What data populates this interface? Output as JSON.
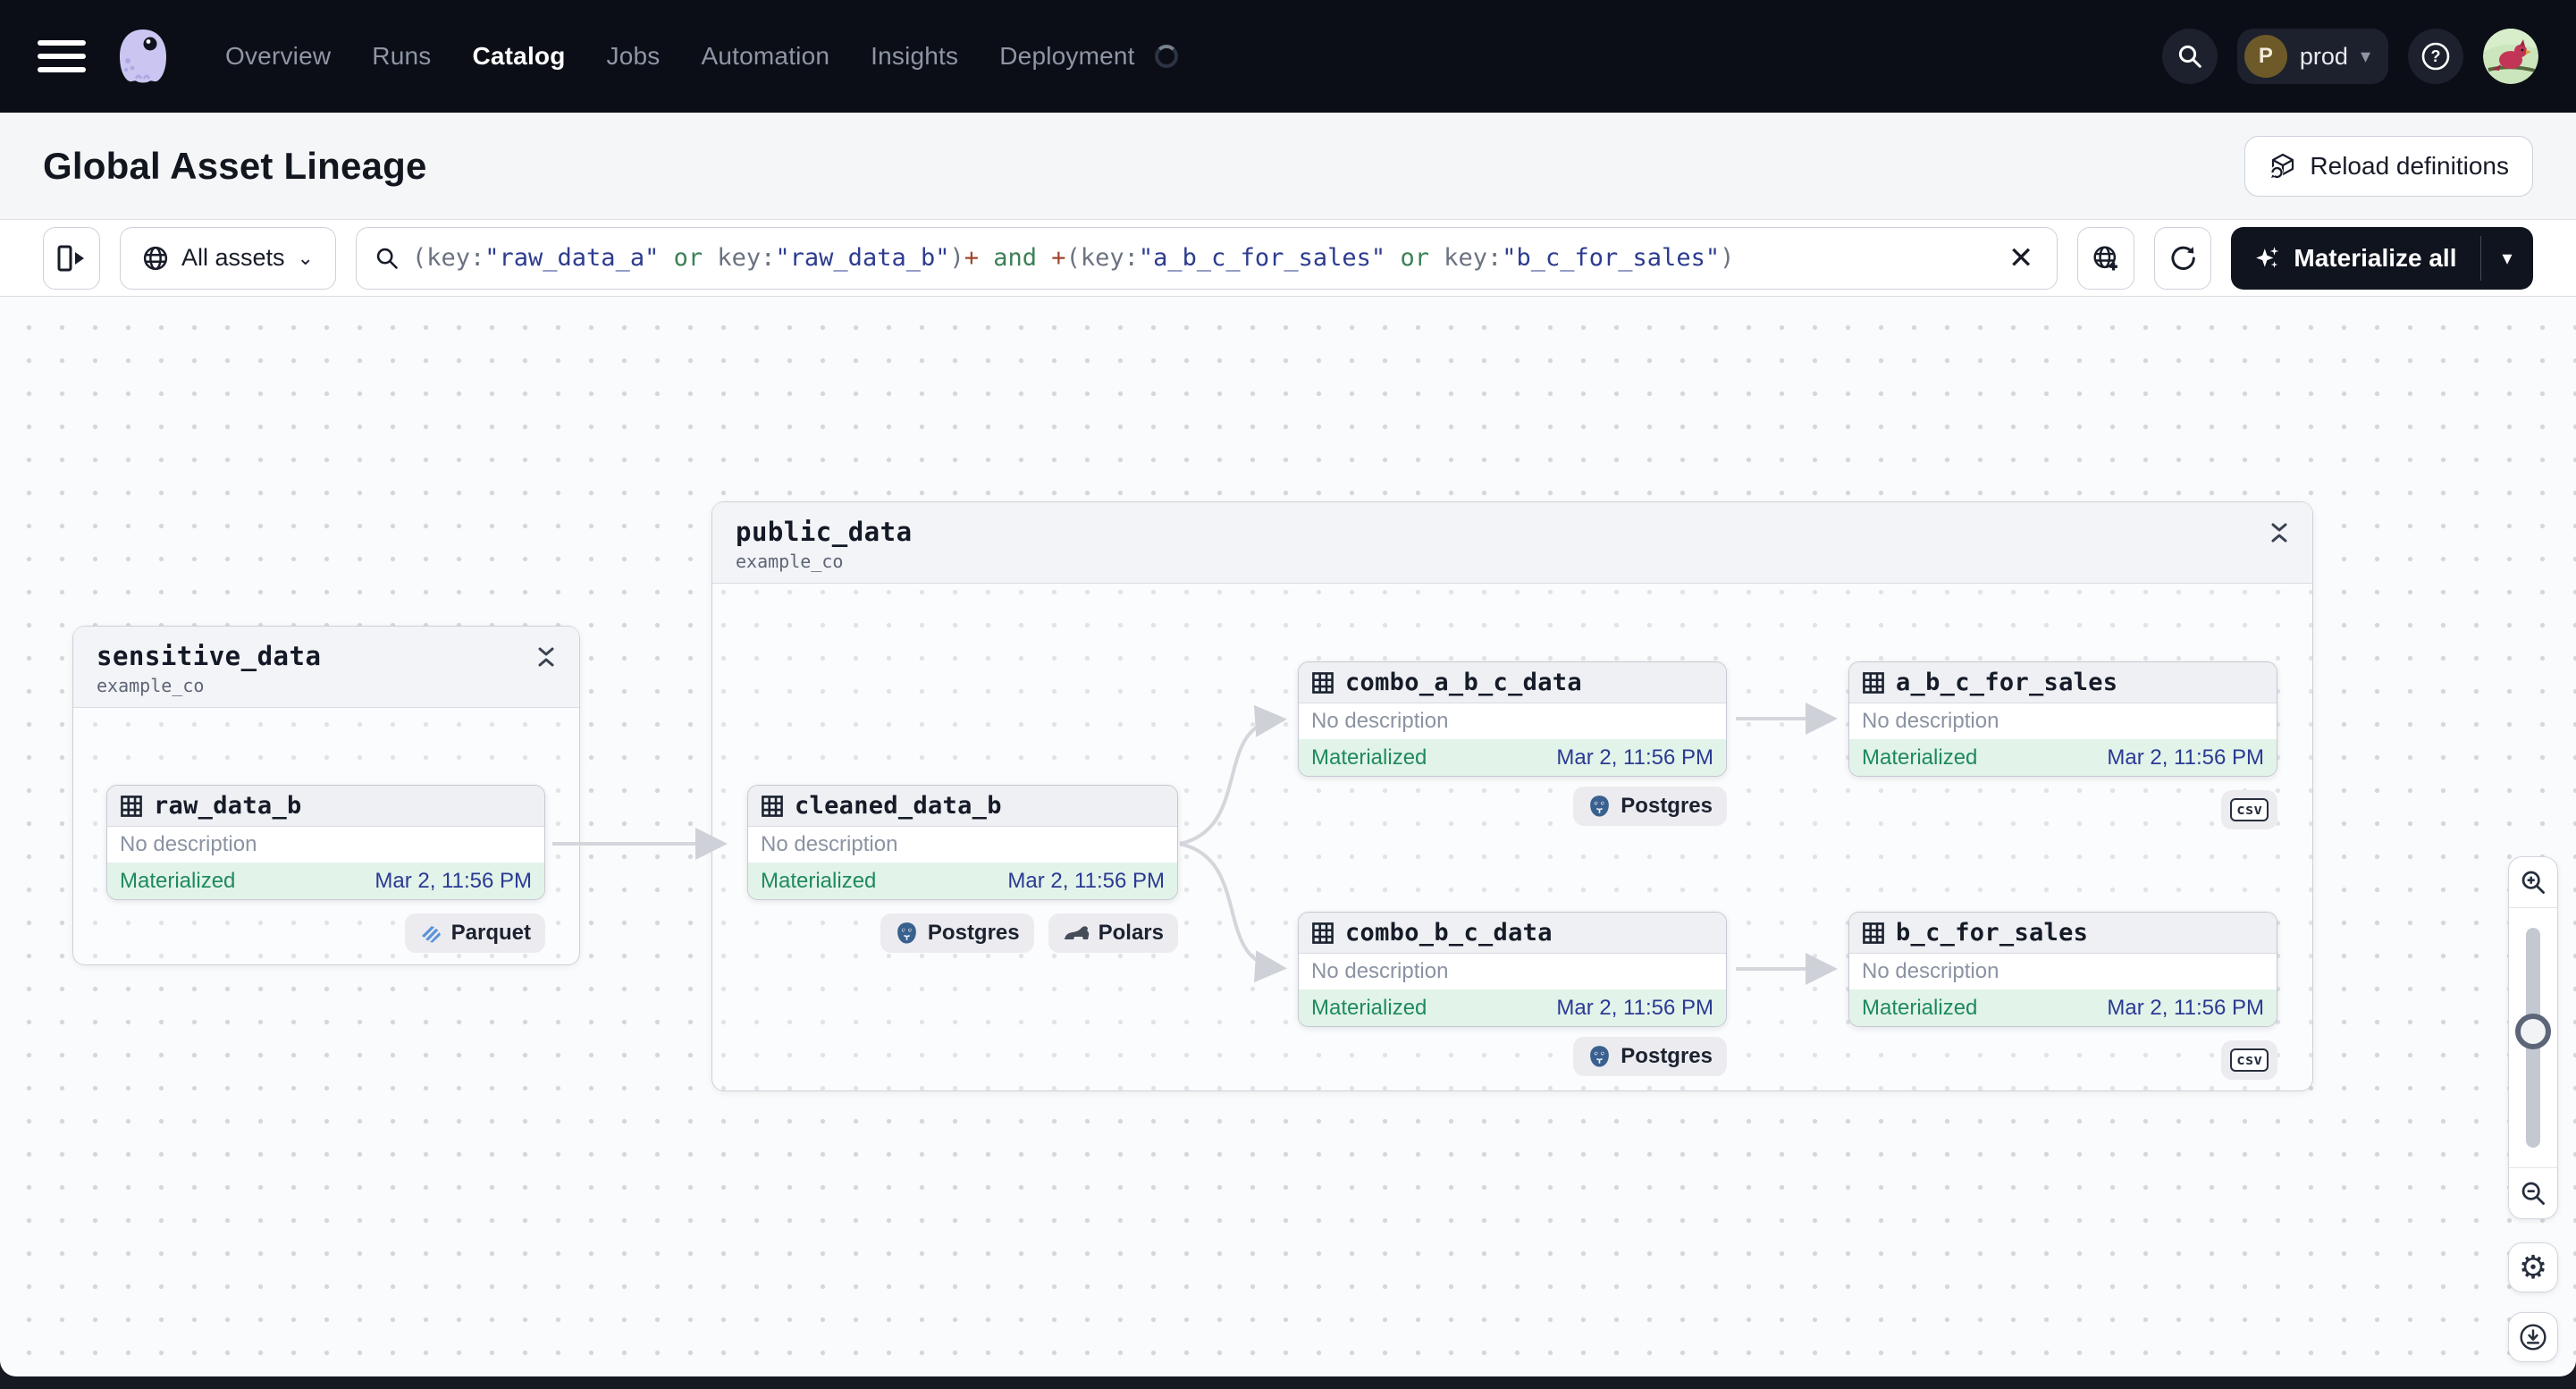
{
  "nav": {
    "items": [
      "Overview",
      "Runs",
      "Catalog",
      "Jobs",
      "Automation",
      "Insights",
      "Deployment"
    ],
    "active_item": "Catalog",
    "deployment_pill": {
      "initial": "P",
      "label": "prod"
    }
  },
  "page_header": {
    "title": "Global Asset Lineage",
    "reload_label": "Reload definitions"
  },
  "toolbar": {
    "scope_label": "All assets",
    "clear_label": "✕",
    "materialize_label": "Materialize all",
    "query_segments": [
      {
        "text": "(key:",
        "type": "punct"
      },
      {
        "text": "\"raw_data_a\"",
        "type": "str"
      },
      {
        "text": " or ",
        "type": "kw"
      },
      {
        "text": "key:",
        "type": "punct"
      },
      {
        "text": "\"raw_data_b\"",
        "type": "str"
      },
      {
        "text": ")",
        "type": "punct"
      },
      {
        "text": "+",
        "type": "plus"
      },
      {
        "text": " and ",
        "type": "kw"
      },
      {
        "text": "+",
        "type": "plus"
      },
      {
        "text": "(key:",
        "type": "punct"
      },
      {
        "text": "\"a_b_c_for_sales\"",
        "type": "str"
      },
      {
        "text": " or ",
        "type": "kw"
      },
      {
        "text": "key:",
        "type": "punct"
      },
      {
        "text": "\"b_c_for_sales\"",
        "type": "str"
      },
      {
        "text": ")",
        "type": "punct"
      }
    ]
  },
  "graph": {
    "groups": [
      {
        "name": "sensitive_data",
        "subtitle": "example_co"
      },
      {
        "name": "public_data",
        "subtitle": "example_co"
      }
    ],
    "assets": [
      {
        "name": "raw_data_b",
        "description": "No description",
        "status": "Materialized",
        "timestamp": "Mar 2, 11:56 PM",
        "badges": [
          {
            "label": "Parquet",
            "icon": "parquet"
          }
        ]
      },
      {
        "name": "cleaned_data_b",
        "description": "No description",
        "status": "Materialized",
        "timestamp": "Mar 2, 11:56 PM",
        "badges": [
          {
            "label": "Postgres",
            "icon": "postgres"
          },
          {
            "label": "Polars",
            "icon": "polars"
          }
        ]
      },
      {
        "name": "combo_a_b_c_data",
        "description": "No description",
        "status": "Materialized",
        "timestamp": "Mar 2, 11:56 PM",
        "badges": [
          {
            "label": "Postgres",
            "icon": "postgres"
          }
        ]
      },
      {
        "name": "a_b_c_for_sales",
        "description": "No description",
        "status": "Materialized",
        "timestamp": "Mar 2, 11:56 PM",
        "badges": [
          {
            "label": "csv",
            "icon": "csv"
          }
        ]
      },
      {
        "name": "combo_b_c_data",
        "description": "No description",
        "status": "Materialized",
        "timestamp": "Mar 2, 11:56 PM",
        "badges": [
          {
            "label": "Postgres",
            "icon": "postgres"
          }
        ]
      },
      {
        "name": "b_c_for_sales",
        "description": "No description",
        "status": "Materialized",
        "timestamp": "Mar 2, 11:56 PM",
        "badges": [
          {
            "label": "csv",
            "icon": "csv"
          }
        ]
      }
    ]
  },
  "colors": {
    "nav_bg": "#0b0e16",
    "status_green": "#1f8a5c",
    "status_bg": "#e2f3e9",
    "timestamp_blue": "#2b3a93",
    "edge_gray": "#d4d6dc",
    "materialize_bg": "#10141e",
    "query_string": "#2d3c8f",
    "query_keyword": "#3c8057",
    "query_plus": "#a0452e"
  }
}
